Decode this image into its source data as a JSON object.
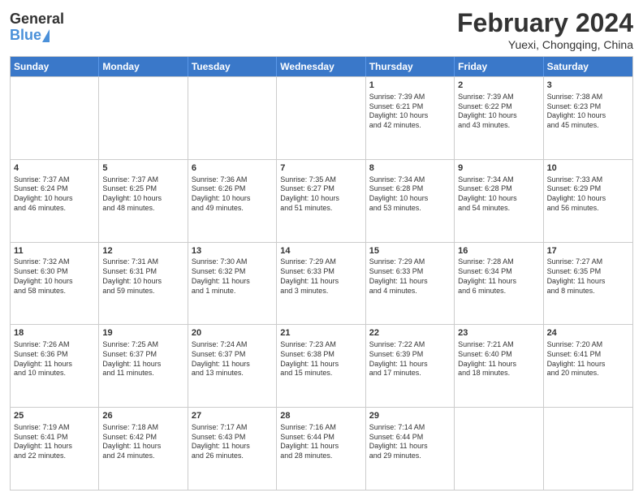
{
  "header": {
    "logo_general": "General",
    "logo_blue": "Blue",
    "title": "February 2024",
    "location": "Yuexi, Chongqing, China"
  },
  "weekdays": [
    "Sunday",
    "Monday",
    "Tuesday",
    "Wednesday",
    "Thursday",
    "Friday",
    "Saturday"
  ],
  "rows": [
    [
      {
        "day": "",
        "info": ""
      },
      {
        "day": "",
        "info": ""
      },
      {
        "day": "",
        "info": ""
      },
      {
        "day": "",
        "info": ""
      },
      {
        "day": "1",
        "info": "Sunrise: 7:39 AM\nSunset: 6:21 PM\nDaylight: 10 hours\nand 42 minutes."
      },
      {
        "day": "2",
        "info": "Sunrise: 7:39 AM\nSunset: 6:22 PM\nDaylight: 10 hours\nand 43 minutes."
      },
      {
        "day": "3",
        "info": "Sunrise: 7:38 AM\nSunset: 6:23 PM\nDaylight: 10 hours\nand 45 minutes."
      }
    ],
    [
      {
        "day": "4",
        "info": "Sunrise: 7:37 AM\nSunset: 6:24 PM\nDaylight: 10 hours\nand 46 minutes."
      },
      {
        "day": "5",
        "info": "Sunrise: 7:37 AM\nSunset: 6:25 PM\nDaylight: 10 hours\nand 48 minutes."
      },
      {
        "day": "6",
        "info": "Sunrise: 7:36 AM\nSunset: 6:26 PM\nDaylight: 10 hours\nand 49 minutes."
      },
      {
        "day": "7",
        "info": "Sunrise: 7:35 AM\nSunset: 6:27 PM\nDaylight: 10 hours\nand 51 minutes."
      },
      {
        "day": "8",
        "info": "Sunrise: 7:34 AM\nSunset: 6:28 PM\nDaylight: 10 hours\nand 53 minutes."
      },
      {
        "day": "9",
        "info": "Sunrise: 7:34 AM\nSunset: 6:28 PM\nDaylight: 10 hours\nand 54 minutes."
      },
      {
        "day": "10",
        "info": "Sunrise: 7:33 AM\nSunset: 6:29 PM\nDaylight: 10 hours\nand 56 minutes."
      }
    ],
    [
      {
        "day": "11",
        "info": "Sunrise: 7:32 AM\nSunset: 6:30 PM\nDaylight: 10 hours\nand 58 minutes."
      },
      {
        "day": "12",
        "info": "Sunrise: 7:31 AM\nSunset: 6:31 PM\nDaylight: 10 hours\nand 59 minutes."
      },
      {
        "day": "13",
        "info": "Sunrise: 7:30 AM\nSunset: 6:32 PM\nDaylight: 11 hours\nand 1 minute."
      },
      {
        "day": "14",
        "info": "Sunrise: 7:29 AM\nSunset: 6:33 PM\nDaylight: 11 hours\nand 3 minutes."
      },
      {
        "day": "15",
        "info": "Sunrise: 7:29 AM\nSunset: 6:33 PM\nDaylight: 11 hours\nand 4 minutes."
      },
      {
        "day": "16",
        "info": "Sunrise: 7:28 AM\nSunset: 6:34 PM\nDaylight: 11 hours\nand 6 minutes."
      },
      {
        "day": "17",
        "info": "Sunrise: 7:27 AM\nSunset: 6:35 PM\nDaylight: 11 hours\nand 8 minutes."
      }
    ],
    [
      {
        "day": "18",
        "info": "Sunrise: 7:26 AM\nSunset: 6:36 PM\nDaylight: 11 hours\nand 10 minutes."
      },
      {
        "day": "19",
        "info": "Sunrise: 7:25 AM\nSunset: 6:37 PM\nDaylight: 11 hours\nand 11 minutes."
      },
      {
        "day": "20",
        "info": "Sunrise: 7:24 AM\nSunset: 6:37 PM\nDaylight: 11 hours\nand 13 minutes."
      },
      {
        "day": "21",
        "info": "Sunrise: 7:23 AM\nSunset: 6:38 PM\nDaylight: 11 hours\nand 15 minutes."
      },
      {
        "day": "22",
        "info": "Sunrise: 7:22 AM\nSunset: 6:39 PM\nDaylight: 11 hours\nand 17 minutes."
      },
      {
        "day": "23",
        "info": "Sunrise: 7:21 AM\nSunset: 6:40 PM\nDaylight: 11 hours\nand 18 minutes."
      },
      {
        "day": "24",
        "info": "Sunrise: 7:20 AM\nSunset: 6:41 PM\nDaylight: 11 hours\nand 20 minutes."
      }
    ],
    [
      {
        "day": "25",
        "info": "Sunrise: 7:19 AM\nSunset: 6:41 PM\nDaylight: 11 hours\nand 22 minutes."
      },
      {
        "day": "26",
        "info": "Sunrise: 7:18 AM\nSunset: 6:42 PM\nDaylight: 11 hours\nand 24 minutes."
      },
      {
        "day": "27",
        "info": "Sunrise: 7:17 AM\nSunset: 6:43 PM\nDaylight: 11 hours\nand 26 minutes."
      },
      {
        "day": "28",
        "info": "Sunrise: 7:16 AM\nSunset: 6:44 PM\nDaylight: 11 hours\nand 28 minutes."
      },
      {
        "day": "29",
        "info": "Sunrise: 7:14 AM\nSunset: 6:44 PM\nDaylight: 11 hours\nand 29 minutes."
      },
      {
        "day": "",
        "info": ""
      },
      {
        "day": "",
        "info": ""
      }
    ]
  ]
}
